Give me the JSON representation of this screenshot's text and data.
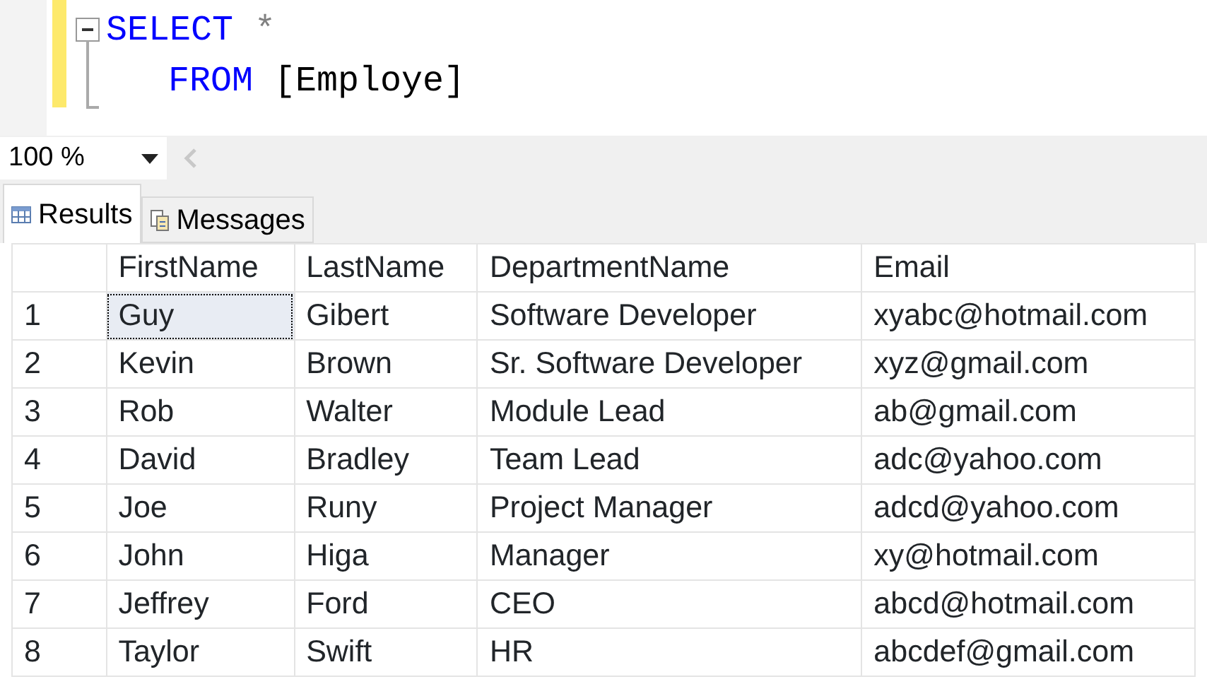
{
  "editor": {
    "lines": [
      {
        "tokens": [
          {
            "kind": "keyword",
            "text": "SELECT"
          },
          {
            "kind": "operator",
            "text": "*"
          }
        ]
      },
      {
        "tokens": [
          {
            "kind": "keyword",
            "text": "FROM"
          },
          {
            "kind": "plain",
            "text": "[Employe]"
          }
        ]
      }
    ]
  },
  "zoom": {
    "value": "100 %"
  },
  "tabs": [
    {
      "label": "Results",
      "selected": true,
      "kind": "grid"
    },
    {
      "label": "Messages",
      "selected": false,
      "kind": "messages"
    }
  ],
  "table": {
    "columns": [
      "FirstName",
      "LastName",
      "DepartmentName",
      "Email"
    ],
    "rows": [
      {
        "number": "1",
        "cells": [
          {
            "text": "Guy",
            "selected": true
          },
          {
            "text": "Gibert",
            "selected": false
          },
          {
            "text": "Software Developer",
            "selected": false
          },
          {
            "text": "xyabc@hotmail.com",
            "selected": false
          }
        ]
      },
      {
        "number": "2",
        "cells": [
          {
            "text": "Kevin",
            "selected": false
          },
          {
            "text": "Brown",
            "selected": false
          },
          {
            "text": "Sr. Software Developer",
            "selected": false
          },
          {
            "text": "xyz@gmail.com",
            "selected": false
          }
        ]
      },
      {
        "number": "3",
        "cells": [
          {
            "text": "Rob",
            "selected": false
          },
          {
            "text": "Walter",
            "selected": false
          },
          {
            "text": "Module Lead",
            "selected": false
          },
          {
            "text": "ab@gmail.com",
            "selected": false
          }
        ]
      },
      {
        "number": "4",
        "cells": [
          {
            "text": "David",
            "selected": false
          },
          {
            "text": "Bradley",
            "selected": false
          },
          {
            "text": "Team Lead",
            "selected": false
          },
          {
            "text": "adc@yahoo.com",
            "selected": false
          }
        ]
      },
      {
        "number": "5",
        "cells": [
          {
            "text": "Joe",
            "selected": false
          },
          {
            "text": "Runy",
            "selected": false
          },
          {
            "text": "Project Manager",
            "selected": false
          },
          {
            "text": "adcd@yahoo.com",
            "selected": false
          }
        ]
      },
      {
        "number": "6",
        "cells": [
          {
            "text": "John",
            "selected": false
          },
          {
            "text": "Higa",
            "selected": false
          },
          {
            "text": "Manager",
            "selected": false
          },
          {
            "text": "xy@hotmail.com",
            "selected": false
          }
        ]
      },
      {
        "number": "7",
        "cells": [
          {
            "text": "Jeffrey",
            "selected": false
          },
          {
            "text": "Ford",
            "selected": false
          },
          {
            "text": "CEO",
            "selected": false
          },
          {
            "text": "abcd@hotmail.com",
            "selected": false
          }
        ]
      },
      {
        "number": "8",
        "cells": [
          {
            "text": "Taylor",
            "selected": false
          },
          {
            "text": "Swift",
            "selected": false
          },
          {
            "text": "HR",
            "selected": false
          },
          {
            "text": "abcdef@gmail.com",
            "selected": false
          }
        ]
      }
    ]
  }
}
